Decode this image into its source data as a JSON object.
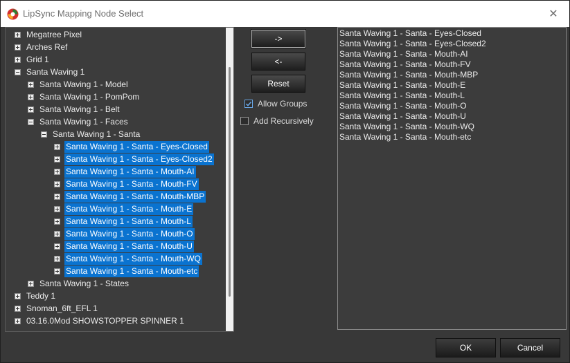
{
  "window": {
    "title": "LipSync Mapping Node Select",
    "close_glyph": "✕"
  },
  "tree": {
    "items": [
      {
        "label": "Megatree Pixel",
        "expander": "plus",
        "selected": false
      },
      {
        "label": "Arches Ref",
        "expander": "plus",
        "selected": false
      },
      {
        "label": "Grid 1",
        "expander": "plus",
        "selected": false
      },
      {
        "label": "Santa Waving 1",
        "expander": "minus",
        "selected": false
      },
      {
        "label": "Santa Waving 1 - Model",
        "expander": "plus",
        "selected": false
      },
      {
        "label": "Santa Waving 1 - PomPom",
        "expander": "plus",
        "selected": false
      },
      {
        "label": "Santa Waving 1 - Belt",
        "expander": "plus",
        "selected": false
      },
      {
        "label": "Santa Waving 1 - Faces",
        "expander": "minus",
        "selected": false
      },
      {
        "label": "Santa Waving 1 - Santa",
        "expander": "minus",
        "selected": false
      },
      {
        "label": "Santa Waving 1 - Santa - Eyes-Closed",
        "expander": "plus",
        "selected": true
      },
      {
        "label": "Santa Waving 1 - Santa - Eyes-Closed2",
        "expander": "plus",
        "selected": true
      },
      {
        "label": "Santa Waving 1 - Santa - Mouth-AI",
        "expander": "plus",
        "selected": true
      },
      {
        "label": "Santa Waving 1 - Santa - Mouth-FV",
        "expander": "plus",
        "selected": true
      },
      {
        "label": "Santa Waving 1 - Santa - Mouth-MBP",
        "expander": "plus",
        "selected": true
      },
      {
        "label": "Santa Waving 1 - Santa - Mouth-E",
        "expander": "plus",
        "selected": true
      },
      {
        "label": "Santa Waving 1 - Santa - Mouth-L",
        "expander": "plus",
        "selected": true
      },
      {
        "label": "Santa Waving 1 - Santa - Mouth-O",
        "expander": "plus",
        "selected": true
      },
      {
        "label": "Santa Waving 1 - Santa - Mouth-U",
        "expander": "plus",
        "selected": true
      },
      {
        "label": "Santa Waving 1 - Santa - Mouth-WQ",
        "expander": "plus",
        "selected": true
      },
      {
        "label": "Santa Waving 1 - Santa - Mouth-etc",
        "expander": "plus",
        "selected": true
      },
      {
        "label": "Santa Waving 1 - States",
        "expander": "plus",
        "selected": false
      },
      {
        "label": "Teddy 1",
        "expander": "plus",
        "selected": false
      },
      {
        "label": "Snoman_6ft_EFL 1",
        "expander": "plus",
        "selected": false
      },
      {
        "label": "03.16.0Mod SHOWSTOPPER SPINNER 1",
        "expander": "plus",
        "selected": false
      }
    ]
  },
  "controls": {
    "add_button": "->",
    "remove_button": "<-",
    "reset_button": "Reset",
    "allow_groups_label": "Allow Groups",
    "allow_groups_checked": true,
    "add_recursively_label": "Add Recursively",
    "add_recursively_checked": false
  },
  "selected_list": [
    "Santa Waving 1 - Santa - Eyes-Closed",
    "Santa Waving 1 - Santa - Eyes-Closed2",
    "Santa Waving 1 - Santa - Mouth-AI",
    "Santa Waving 1 - Santa - Mouth-FV",
    "Santa Waving 1 - Santa - Mouth-MBP",
    "Santa Waving 1 - Santa - Mouth-E",
    "Santa Waving 1 - Santa - Mouth-L",
    "Santa Waving 1 - Santa - Mouth-O",
    "Santa Waving 1 - Santa - Mouth-U",
    "Santa Waving 1 - Santa - Mouth-WQ",
    "Santa Waving 1 - Santa - Mouth-etc"
  ],
  "footer": {
    "ok_label": "OK",
    "cancel_label": "Cancel"
  },
  "colors": {
    "selection": "#0a73d0",
    "panel_bg": "#3c3c3c",
    "window_bg": "#383838"
  }
}
